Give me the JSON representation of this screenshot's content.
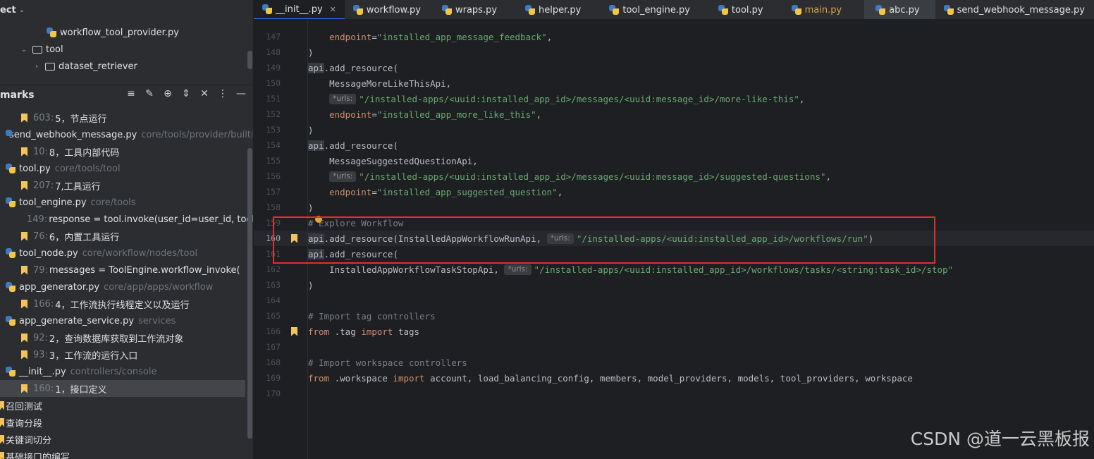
{
  "project_panel": {
    "title": "ect",
    "items": [
      {
        "label": "workflow_tool_provider.py",
        "kind": "file"
      },
      {
        "label": "tool",
        "kind": "folder",
        "expanded": true
      },
      {
        "label": "dataset_retriever",
        "kind": "folder",
        "expanded": false
      }
    ]
  },
  "bookmarks_panel": {
    "title": "marks",
    "toolbar_icons": [
      "list-add-icon",
      "edit-icon",
      "locate-icon",
      "expand-icon",
      "collapse-icon",
      "more-icon",
      "minimize-icon"
    ],
    "rows": [
      {
        "type": "bookmark",
        "line": "603:",
        "desc": "5，节点运行"
      },
      {
        "type": "file",
        "name": "send_webhook_message.py",
        "path": "core/tools/provider/builti"
      },
      {
        "type": "bookmark",
        "line": "10:",
        "desc": "8，工具内部代码"
      },
      {
        "type": "file",
        "name": "tool.py",
        "path": "core/tools/tool"
      },
      {
        "type": "bookmark",
        "line": "207:",
        "desc": "7,工具运行"
      },
      {
        "type": "file",
        "name": "tool_engine.py",
        "path": "core/tools"
      },
      {
        "type": "bookmark",
        "line": "149:",
        "desc": "response = tool.invoke(user_id=user_id, tool_p"
      },
      {
        "type": "bookmark",
        "line": "76:",
        "desc": "6，内置工具运行"
      },
      {
        "type": "file",
        "name": "tool_node.py",
        "path": "core/workflow/nodes/tool"
      },
      {
        "type": "bookmark",
        "line": "79:",
        "desc": "messages = ToolEngine.workflow_invoke("
      },
      {
        "type": "file",
        "name": "app_generator.py",
        "path": "core/app/apps/workflow"
      },
      {
        "type": "bookmark",
        "line": "166:",
        "desc": "4，工作流执行线程定义以及运行"
      },
      {
        "type": "file",
        "name": "app_generate_service.py",
        "path": "services"
      },
      {
        "type": "bookmark",
        "line": "92:",
        "desc": "2，查询数据库获取到工作流对象"
      },
      {
        "type": "bookmark",
        "line": "93:",
        "desc": "3，工作流的运行入口"
      },
      {
        "type": "file",
        "name": "__init__.py",
        "path": "controllers/console"
      },
      {
        "type": "bookmark",
        "line": "160:",
        "desc": "1，接口定义",
        "selected": true
      }
    ],
    "groups": [
      "召回测试",
      "查询分段",
      "关键词切分",
      "基础接口的编写"
    ]
  },
  "tabs": [
    {
      "label": "__init__.py",
      "active": true
    },
    {
      "label": "workflow.py"
    },
    {
      "label": "wraps.py"
    },
    {
      "label": "helper.py"
    },
    {
      "label": "tool_engine.py"
    },
    {
      "label": "tool.py"
    },
    {
      "label": "main.py"
    },
    {
      "label": "abc.py"
    },
    {
      "label": "send_webhook_message.py"
    }
  ],
  "editor": {
    "hint_label": "urls:",
    "line_numbers": [
      "147",
      "148",
      "149",
      "150",
      "151",
      "152",
      "153",
      "154",
      "155",
      "156",
      "157",
      "158",
      "159",
      "160",
      "161",
      "162",
      "163",
      "164",
      "165",
      "166",
      "167",
      "168",
      "169",
      "170"
    ],
    "code": {
      "l147_param": "endpoint",
      "l147_val": "\"installed_app_message_feedback\"",
      "l148": ")",
      "l149_api": "api",
      "l149_rest": ".add_resource(",
      "l150": "    MessageMoreLikeThisApi,",
      "l151_str": "\"/installed-apps/<uuid:installed_app_id>/messages/<uuid:message_id>/more-like-this\"",
      "l152_param": "endpoint",
      "l152_val": "\"installed_app_more_like_this\"",
      "l153": ")",
      "l154_api": "api",
      "l154_rest": ".add_resource(",
      "l155": "    MessageSuggestedQuestionApi,",
      "l156_str": "\"/installed-apps/<uuid:installed_app_id>/messages/<uuid:message_id>/suggested-questions\"",
      "l157_param": "endpoint",
      "l157_val": "\"installed_app_suggested_question\"",
      "l158": ")",
      "l159": "# Explore Workflow",
      "l160_api": "api",
      "l160_rest": ".add_resource(InstalledAppWorkflowRunApi, ",
      "l160_str": "\"/installed-apps/<uuid:installed_app_id>/workflows/run\"",
      "l160_end": ")",
      "l161_api": "api",
      "l161_rest": ".add_resource(",
      "l162_code": "    InstalledAppWorkflowTaskStopApi, ",
      "l162_str": "\"/installed-apps/<uuid:installed_app_id>/workflows/tasks/<string:task_id>/stop\"",
      "l163": ")",
      "l165": "# Import tag controllers",
      "l166_from": "from",
      "l166_mod": " .tag ",
      "l166_import": "import",
      "l166_names": " tags",
      "l168": "# Import workspace controllers",
      "l169_from": "from",
      "l169_mod": " .workspace ",
      "l169_import": "import",
      "l169_names": " account, load_balancing_config, members, model_providers, models, tool_providers, workspace"
    }
  },
  "watermark": "CSDN @道一云黑板报",
  "colors": {
    "highlight_box": "#e52e2e",
    "bookmark": "#f2c55c",
    "active_tab_underline": "#3574f0"
  }
}
